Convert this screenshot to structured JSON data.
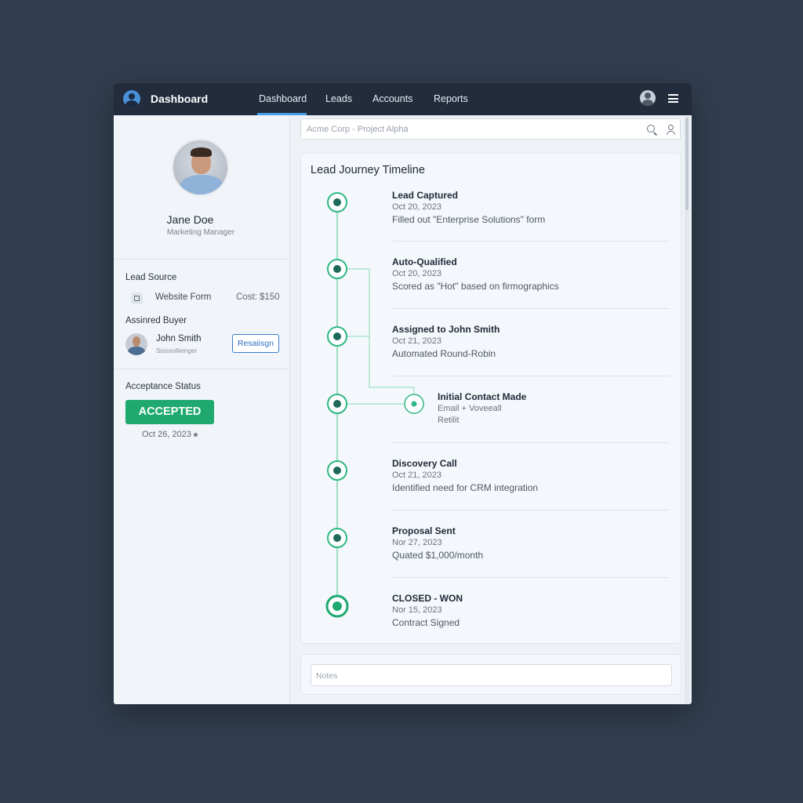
{
  "header": {
    "brand_title": "Dashboard",
    "tabs": [
      "Dashboard",
      "Leads",
      "Accounts",
      "Reports"
    ],
    "active_tab": "Dashboard"
  },
  "profile": {
    "name": "Jane Doe",
    "role": "Marketing Manager"
  },
  "lead_source": {
    "title": "Lead Source",
    "value": "Website Form",
    "cost": "Cost: $150"
  },
  "assigned_buyer": {
    "title": "Assinred Buyer",
    "name": "John Smith",
    "subtitle": "Sisssollienger",
    "reassign_label": "Resaiisgn"
  },
  "acceptance": {
    "title": "Acceptance Status",
    "status": "ACCEPTED",
    "date": "Oct 26, 2023",
    "status_color": "#1fa971"
  },
  "search": {
    "placeholder": "Acme Corp - Project Alpha"
  },
  "timeline": {
    "title": "Lead Journey Timeline",
    "accent_color": "#1fa971",
    "events": [
      {
        "title": "Lead Captured",
        "date": "Oct 20, 2023",
        "desc": "Filled out \"Enterprise Solutions\" form"
      },
      {
        "title": "Auto-Qualified",
        "date": "Oct 20, 2023",
        "desc": "Scored as \"Hot\" based on firmographics"
      },
      {
        "title": "Assigned to John Smith",
        "date": "Oct 21, 2023",
        "desc": "Automated Round-Robin"
      },
      {
        "title": "Initial Contact Made",
        "date": "Email + Voveeall",
        "desc": "Retilit"
      },
      {
        "title": "Discovery Call",
        "date": "Oct 21, 2023",
        "desc": "Identified need for CRM integration"
      },
      {
        "title": "Proposal Sent",
        "date": "Nor 27, 2023",
        "desc": "Quated $1,000/month"
      },
      {
        "title": "CLOSED - WON",
        "date": "Nor 15, 2023",
        "desc": "Contract Signed"
      }
    ]
  },
  "notes": {
    "placeholder": "Notes"
  }
}
